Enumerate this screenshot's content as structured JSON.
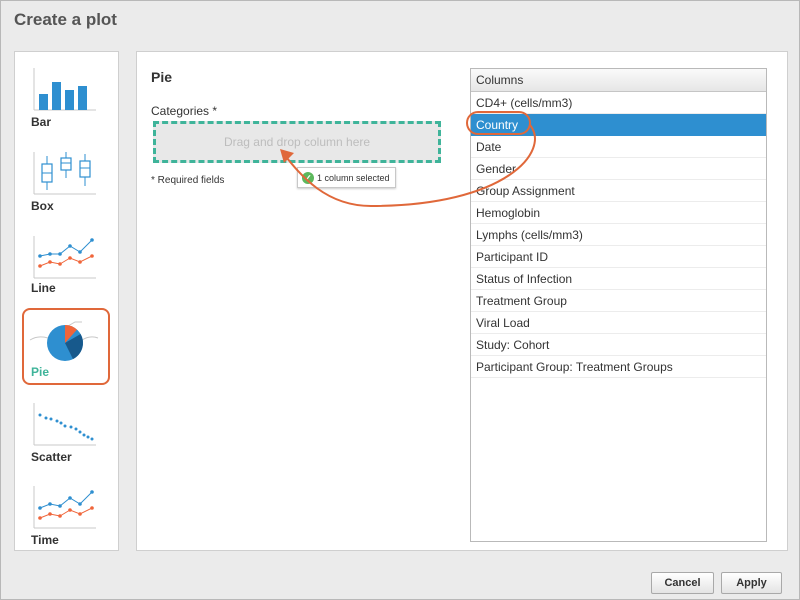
{
  "dialog": {
    "title": "Create a plot"
  },
  "plot_types": [
    {
      "label": "Bar",
      "icon": "bar-chart-icon"
    },
    {
      "label": "Box",
      "icon": "box-plot-icon"
    },
    {
      "label": "Line",
      "icon": "line-chart-icon"
    },
    {
      "label": "Pie",
      "icon": "pie-chart-icon",
      "selected": true
    },
    {
      "label": "Scatter",
      "icon": "scatter-plot-icon"
    },
    {
      "label": "Time",
      "icon": "time-chart-icon"
    }
  ],
  "main": {
    "heading": "Pie",
    "categories_label": "Categories *",
    "drop_placeholder": "Drag and drop column here",
    "required_note": "* Required fields",
    "drag_tooltip": "1 column selected"
  },
  "columns": {
    "header": "Columns",
    "items": [
      "CD4+ (cells/mm3)",
      "Country",
      "Date",
      "Gender",
      "Group Assignment",
      "Hemoglobin",
      "Lymphs (cells/mm3)",
      "Participant ID",
      "Status of Infection",
      "Treatment Group",
      "Viral Load",
      "Study: Cohort",
      "Participant Group: Treatment Groups"
    ],
    "selected": "Country"
  },
  "buttons": {
    "cancel": "Cancel",
    "apply": "Apply"
  },
  "colors": {
    "accent_green": "#3fb49a",
    "highlight_orange": "#e0683a",
    "selection_blue": "#2e8fd0",
    "chart_blue": "#2e8fd0",
    "chart_dark_blue": "#17598c",
    "chart_orange": "#f0653a"
  }
}
